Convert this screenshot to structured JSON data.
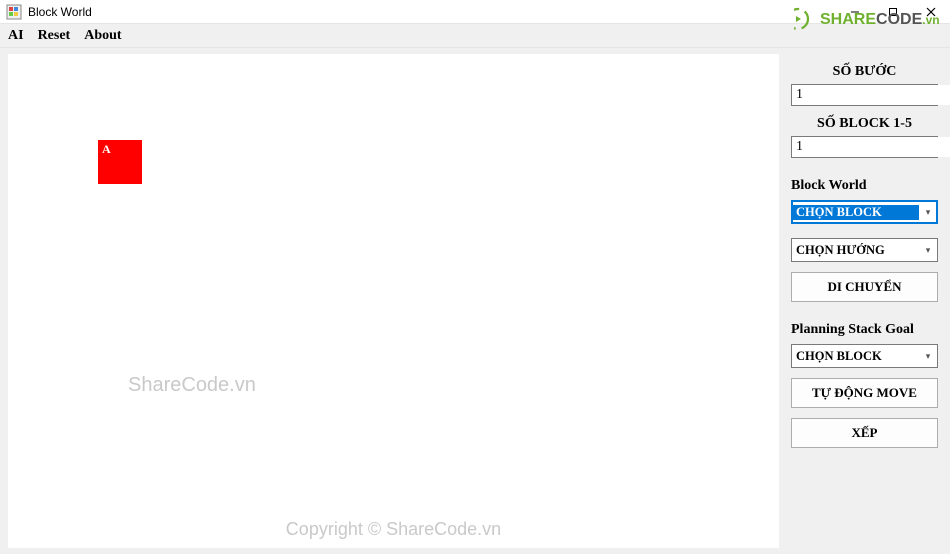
{
  "window": {
    "title": "Block World"
  },
  "menu": {
    "ai": "AI",
    "reset": "Reset",
    "about": "About"
  },
  "canvas": {
    "block_a_label": "A"
  },
  "side": {
    "steps_label": "SỐ BƯỚC",
    "steps_value": "1",
    "blocks_label": "SỐ BLOCK 1-5",
    "blocks_value": "1",
    "group1_title": "Block World",
    "select_block": "CHỌN BLOCK",
    "select_direction": "CHỌN HƯỚNG",
    "move_btn": "DI CHUYỂN",
    "group2_title": "Planning Stack Goal",
    "select_block2": "CHỌN BLOCK",
    "auto_move_btn": "TỰ ĐỘNG MOVE",
    "stack_btn": "XẾP"
  },
  "watermarks": {
    "left": "ShareCode.vn",
    "center": "Copyright © ShareCode.vn"
  },
  "logo": {
    "share": "SHARE",
    "code": "CODE",
    "tld": ".vn"
  }
}
